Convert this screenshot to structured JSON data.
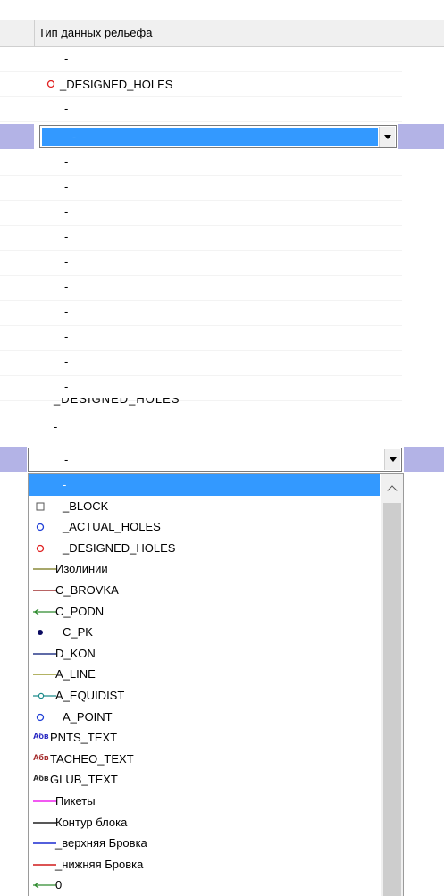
{
  "grid": {
    "column_header": "Тип данных рельефа",
    "dash": "-",
    "designed_row_label": "_DESIGNED_HOLES",
    "combo_top_value": "-",
    "combo_bottom_value": "-"
  },
  "dropdown": {
    "selected_value": "-",
    "items": [
      {
        "label": "-",
        "icon": "none",
        "selected": true
      },
      {
        "label": "_BLOCK",
        "icon": "square-icon",
        "color": "#555555"
      },
      {
        "label": "_ACTUAL_HOLES",
        "icon": "circle-icon",
        "color": "#1f3fd6"
      },
      {
        "label": "_DESIGNED_HOLES",
        "icon": "circle-icon",
        "color": "#e02020"
      },
      {
        "label": "Изолинии",
        "icon": "line-icon",
        "color": "#8a8a3a"
      },
      {
        "label": "C_BROVKA",
        "icon": "line-icon",
        "color": "#a03030"
      },
      {
        "label": "C_PODN",
        "icon": "arrow-line-icon",
        "color": "#2e8b2e"
      },
      {
        "label": "C_PK",
        "icon": "dot-icon",
        "color": "#0a0a60"
      },
      {
        "label": "D_KON",
        "icon": "line-icon",
        "color": "#2a3a8a"
      },
      {
        "label": "A_LINE",
        "icon": "line-icon",
        "color": "#9a9a30"
      },
      {
        "label": "A_EQUIDIST",
        "icon": "circle-line-icon",
        "color": "#1a8a8a"
      },
      {
        "label": "A_POINT",
        "icon": "circle-icon",
        "color": "#1f3fd6"
      },
      {
        "label": "PNTS_TEXT",
        "icon": "text-icon",
        "abbr": "Абв",
        "color": "#2020c0"
      },
      {
        "label": "TACHEO_TEXT",
        "icon": "text-icon",
        "abbr": "Абв",
        "color": "#a02020"
      },
      {
        "label": "GLUB_TEXT",
        "icon": "text-icon",
        "abbr": "Абв",
        "color": "#202020"
      },
      {
        "label": "Пикеты",
        "icon": "line-icon",
        "color": "#ee22ee"
      },
      {
        "label": "Контур блока",
        "icon": "line-icon",
        "color": "#202020"
      },
      {
        "label": "_верхняя Бровка",
        "icon": "line-icon",
        "color": "#1a2ad0"
      },
      {
        "label": "_нижняя Бровка",
        "icon": "line-icon",
        "color": "#d01a1a"
      },
      {
        "label": "0",
        "icon": "arrow-line-icon",
        "color": "#2e8b2e"
      }
    ]
  },
  "colors": {
    "selection_band": "#b3b3e6",
    "selected_item": "#3399ff"
  }
}
